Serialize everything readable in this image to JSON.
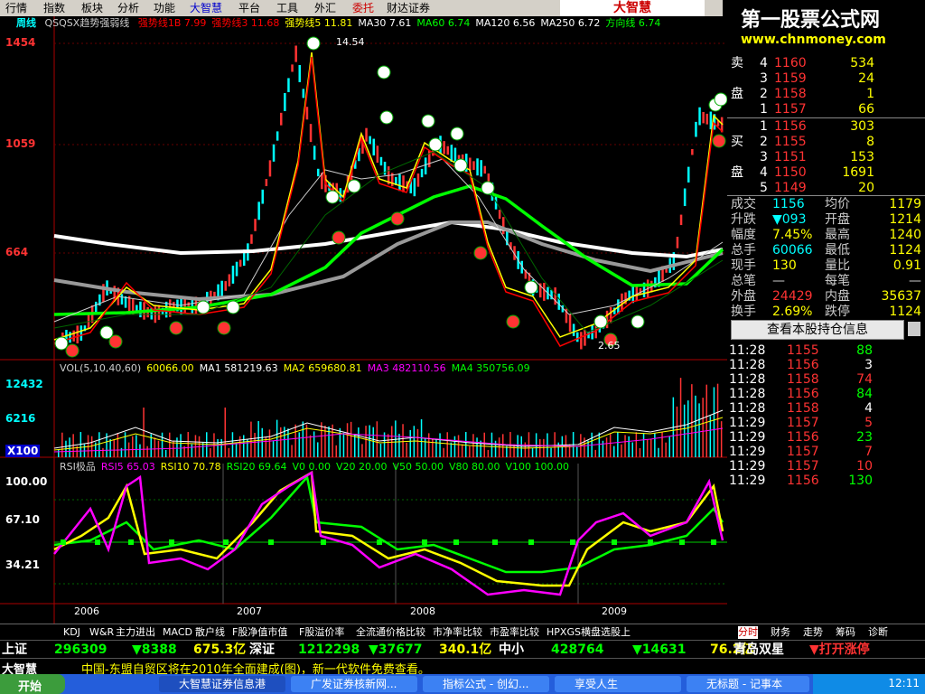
{
  "menu": [
    "行情",
    "指数",
    "板块",
    "分析",
    "功能",
    "大智慧",
    "平台",
    "工具",
    "外汇",
    "委托",
    "财达证券"
  ],
  "brand": "大智慧",
  "watermark": {
    "line1": "第一股票公式网",
    "line2": "www.chnmoney.com"
  },
  "chart": {
    "period": "周线",
    "title": "QSQSX趋势强弱线",
    "indicators": [
      {
        "text": "强势线1B 7.99",
        "color": "#ff0000"
      },
      {
        "text": "强势线3 11.68",
        "color": "#ff0000"
      },
      {
        "text": "强势线5 11.81",
        "color": "#ffff00"
      },
      {
        "text": "MA30 7.61",
        "color": "#ffffff"
      },
      {
        "text": "MA60 6.74",
        "color": "#00ff00"
      },
      {
        "text": "MA120 6.56",
        "color": "#ffffff"
      },
      {
        "text": "MA250 6.72",
        "color": "#ffffff"
      },
      {
        "text": "方向线 6.74",
        "color": "#00ff00"
      }
    ],
    "price_axis": [
      "1454",
      "1059",
      "664"
    ],
    "high_label": "14.54",
    "low_label": "2.65",
    "vol_info": [
      {
        "text": "VOL(5,10,40,60)",
        "color": "#ccc"
      },
      {
        "text": "60066.00",
        "color": "#ffff00"
      },
      {
        "text": "MA1 581219.63",
        "color": "#ffffff"
      },
      {
        "text": "MA2 659680.81",
        "color": "#ffff00"
      },
      {
        "text": "MA3 482110.56",
        "color": "#ff00ff"
      },
      {
        "text": "MA4 350756.09",
        "color": "#00ff00"
      }
    ],
    "vol_axis": [
      "12432",
      "6216",
      "X100"
    ],
    "rsi_info": [
      {
        "text": "RSI极品",
        "color": "#ccc"
      },
      {
        "text": "RSI5 65.03",
        "color": "#ff00ff"
      },
      {
        "text": "RSI10 70.78",
        "color": "#ffff00"
      },
      {
        "text": "RSI20 69.64",
        "color": "#00ff00"
      },
      {
        "text": "V0 0.00",
        "color": "#00ff00"
      },
      {
        "text": "V20 20.00",
        "color": "#00ff00"
      },
      {
        "text": "V50 50.00",
        "color": "#00ff00"
      },
      {
        "text": "V80 80.00",
        "color": "#00ff00"
      },
      {
        "text": "V100 100.00",
        "color": "#00ff00"
      }
    ],
    "rsi_axis": [
      "100.00",
      "67.10",
      "34.21"
    ],
    "years": [
      "2006",
      "2007",
      "2008",
      "2009"
    ]
  },
  "orderbook": {
    "sell": [
      {
        "label": "卖",
        "n": "4",
        "price": "1160",
        "vol": "534"
      },
      {
        "label": "",
        "n": "3",
        "price": "1159",
        "vol": "24"
      },
      {
        "label": "盘",
        "n": "2",
        "price": "1158",
        "vol": "1"
      },
      {
        "label": "",
        "n": "1",
        "price": "1157",
        "vol": "66"
      }
    ],
    "buy": [
      {
        "label": "",
        "n": "1",
        "price": "1156",
        "vol": "303"
      },
      {
        "label": "买",
        "n": "2",
        "price": "1155",
        "vol": "8"
      },
      {
        "label": "",
        "n": "3",
        "price": "1151",
        "vol": "153"
      },
      {
        "label": "盘",
        "n": "4",
        "price": "1150",
        "vol": "1691"
      },
      {
        "label": "",
        "n": "5",
        "price": "1149",
        "vol": "20"
      }
    ]
  },
  "stats": [
    {
      "k1": "成交",
      "v1": "1156",
      "k2": "均价",
      "v2": "1179",
      "c1": "#00ffff",
      "c2": "#ffff00"
    },
    {
      "k1": "升跌",
      "v1": "▼093",
      "k2": "开盘",
      "v2": "1214",
      "c1": "#00ffff",
      "c2": "#ffff00"
    },
    {
      "k1": "幅度",
      "v1": "7.45%",
      "k2": "最高",
      "v2": "1240",
      "c1": "#ffff00",
      "c2": "#ffff00"
    },
    {
      "k1": "总手",
      "v1": "60066",
      "k2": "最低",
      "v2": "1124",
      "c1": "#00ffff",
      "c2": "#ffff00"
    },
    {
      "k1": "现手",
      "v1": "130",
      "k2": "量比",
      "v2": "0.91",
      "c1": "#ffff00",
      "c2": "#ffff00"
    },
    {
      "k1": "总笔",
      "v1": "—",
      "k2": "每笔",
      "v2": "—",
      "c1": "#ccc",
      "c2": "#ccc"
    },
    {
      "k1": "外盘",
      "v1": "24429",
      "k2": "内盘",
      "v2": "35637",
      "c1": "#ff3333",
      "c2": "#ffff00"
    },
    {
      "k1": "换手",
      "v1": "2.69%",
      "k2": "跌停",
      "v2": "1124",
      "c1": "#ffff00",
      "c2": "#ffff00"
    }
  ],
  "holding_button": "查看本股持仓信息",
  "ticks": [
    {
      "t": "11:28",
      "p": "1155",
      "v": "88",
      "c": "#00ff00"
    },
    {
      "t": "11:28",
      "p": "1156",
      "v": "3",
      "c": "#ffffff"
    },
    {
      "t": "11:28",
      "p": "1158",
      "v": "74",
      "c": "#ff3333"
    },
    {
      "t": "11:28",
      "p": "1156",
      "v": "84",
      "c": "#00ff00"
    },
    {
      "t": "11:28",
      "p": "1158",
      "v": "4",
      "c": "#ffffff"
    },
    {
      "t": "11:29",
      "p": "1157",
      "v": "5",
      "c": "#ff3333"
    },
    {
      "t": "11:29",
      "p": "1156",
      "v": "23",
      "c": "#00ff00"
    },
    {
      "t": "11:29",
      "p": "1157",
      "v": "7",
      "c": "#ff3333"
    },
    {
      "t": "11:29",
      "p": "1157",
      "v": "10",
      "c": "#ff3333"
    },
    {
      "t": "11:29",
      "p": "1156",
      "v": "130",
      "c": "#00ff00"
    }
  ],
  "bottom_tabs": [
    "KDJ",
    "W&R",
    "主力进出",
    "MACD",
    "散户线",
    "F股净值市值",
    "F股溢价率",
    "全流通价格比较",
    "市净率比较",
    "市盈率比较",
    "HPXGS横盘选股上"
  ],
  "right_tabs": [
    "分时",
    "财务",
    "走势",
    "筹码",
    "诊断"
  ],
  "index_bar": [
    {
      "text": "上证",
      "color": "#ffffff"
    },
    {
      "text": "296309",
      "color": "#00ff00"
    },
    {
      "text": "▼8388",
      "color": "#00ff00"
    },
    {
      "text": "675.3亿",
      "color": "#ffff00"
    },
    {
      "text": "深证",
      "color": "#ffffff"
    },
    {
      "text": "1212298",
      "color": "#00ff00"
    },
    {
      "text": "▼37677",
      "color": "#00ff00"
    },
    {
      "text": "340.1亿",
      "color": "#ffff00"
    },
    {
      "text": "中小",
      "color": "#ffffff"
    },
    {
      "text": "428764",
      "color": "#00ff00"
    },
    {
      "text": "▼14631",
      "color": "#00ff00"
    },
    {
      "text": "76.2亿",
      "color": "#ffff00"
    },
    {
      "text": "青岛双星",
      "color": "#ffffff"
    },
    {
      "text": "▼打开涨停",
      "color": "#ff3333"
    }
  ],
  "news": {
    "brand": "大智慧",
    "text": "中国-东盟自贸区将在2010年全面建成(图)，新一代软件免费查看。"
  },
  "taskbar": {
    "start": "开始",
    "buttons": [
      "大智慧证券信息港",
      "广发证券核新网...",
      "指标公式 - 创幻...",
      "享受人生",
      "无标题 - 记事本"
    ],
    "clock": "12:11"
  }
}
